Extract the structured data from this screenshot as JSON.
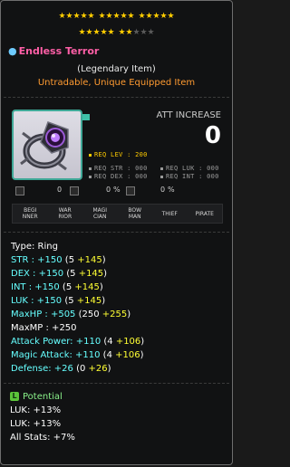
{
  "stars": {
    "row1_filled": 15,
    "row1_groups": 3,
    "row2_filled": 7,
    "row2_empty": 3
  },
  "item": {
    "name": "Endless Terror",
    "rarity": "(Legendary Item)",
    "trade": "Untradable, Unique Equipped Item",
    "icon": "ring-icon"
  },
  "attack_increase": {
    "label": "ATT INCREASE",
    "value": "0"
  },
  "requirements": {
    "lev": "REQ LEV : 200",
    "str": "REQ STR : 000",
    "luk": "REQ LUK : 000",
    "dex": "REQ DEX : 000",
    "int": "REQ INT : 000"
  },
  "mini_stats": [
    {
      "icon": "scroll-icon",
      "value": "0"
    },
    {
      "icon": "hammer-icon",
      "value": "0"
    },
    {
      "icon": "percent-icon",
      "value": "%"
    },
    {
      "icon": "shield-icon",
      "value": "0"
    },
    {
      "icon": "percent2-icon",
      "value": "%"
    }
  ],
  "jobs": [
    "BEGI\nNNER",
    "WAR\nRIOR",
    "MAGI\nCIAN",
    "BOW\nMAN",
    "THIEF",
    "PIRATE"
  ],
  "stats": [
    {
      "label": "Type: Ring",
      "parts": []
    },
    {
      "color": "cyan",
      "base": "STR : +150",
      "open": " (5 ",
      "bonus": "+145",
      "close": ")"
    },
    {
      "color": "cyan",
      "base": "DEX : +150",
      "open": " (5 ",
      "bonus": "+145",
      "close": ")"
    },
    {
      "color": "cyan",
      "base": "INT : +150",
      "open": " (5 ",
      "bonus": "+145",
      "close": ")"
    },
    {
      "color": "cyan",
      "base": "LUK : +150",
      "open": " (5 ",
      "bonus": "+145",
      "close": ")"
    },
    {
      "color": "cyan",
      "base": "MaxHP : +505",
      "open": " (250 ",
      "bonus": "+255",
      "close": ")"
    },
    {
      "color": "white",
      "base": "MaxMP : +250",
      "open": "",
      "bonus": "",
      "close": ""
    },
    {
      "color": "cyan",
      "base": "Attack Power: +110",
      "open": " (4 ",
      "bonus": "+106",
      "close": ")"
    },
    {
      "color": "cyan",
      "base": "Magic Attack: +110",
      "open": " (4 ",
      "bonus": "+106",
      "close": ")"
    },
    {
      "color": "cyan",
      "base": "Defense: +26",
      "open": " (0 ",
      "bonus": "+26",
      "close": ")"
    }
  ],
  "potential": {
    "badge": "L",
    "title": "Potential",
    "lines": [
      "LUK: +13%",
      "LUK: +13%",
      "All Stats: +7%"
    ]
  },
  "colors": {
    "name": "#ff5fa7",
    "trade": "#ff9b31",
    "stat_cyan": "#66ffff",
    "bonus_yellow": "#ffff33",
    "potential": "#8af28a",
    "border_teal": "#3fa897"
  }
}
